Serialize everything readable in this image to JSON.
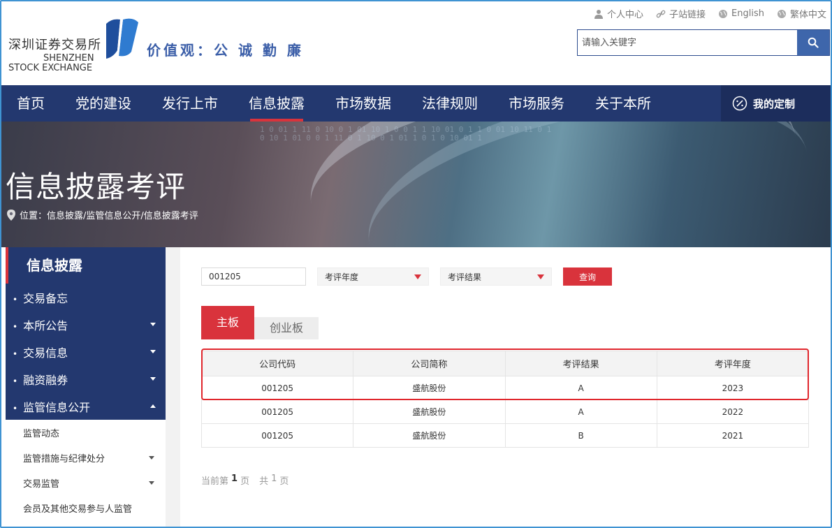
{
  "header": {
    "logo_cn": "深圳证券交易所",
    "logo_en_line1": "SHENZHEN",
    "logo_en_line2": "STOCK EXCHANGE",
    "slogan": "价值观：公 诚 勤 廉",
    "links": [
      {
        "label": "个人中心",
        "icon": "user-icon"
      },
      {
        "label": "子站链接",
        "icon": "link-icon"
      },
      {
        "label": "English",
        "icon": "globe-icon"
      },
      {
        "label": "繁体中文",
        "icon": "globe-icon"
      }
    ],
    "search": {
      "placeholder": "请输入关键字",
      "icon": "search-icon"
    }
  },
  "nav": {
    "items": [
      "首页",
      "党的建设",
      "发行上市",
      "信息披露",
      "市场数据",
      "法律规则",
      "市场服务",
      "关于本所"
    ],
    "active": "信息披露",
    "custom_label": "我的定制"
  },
  "banner": {
    "title": "信息披露考评",
    "breadcrumb": "位置：信息披露/监管信息公开/信息披露考评"
  },
  "sidebar": {
    "title": "信息披露",
    "groups": [
      {
        "label": "交易备忘",
        "caret": ""
      },
      {
        "label": "本所公告",
        "caret": "down"
      },
      {
        "label": "交易信息",
        "caret": "down"
      },
      {
        "label": "融资融券",
        "caret": "down"
      },
      {
        "label": "监管信息公开",
        "caret": "up"
      }
    ],
    "subitems": [
      {
        "label": "监管动态",
        "caret": ""
      },
      {
        "label": "监管措施与纪律处分",
        "caret": "down"
      },
      {
        "label": "交易监管",
        "caret": "down"
      },
      {
        "label": "会员及其他交易参与人监管",
        "caret": ""
      }
    ]
  },
  "filters": {
    "code_value": "001205",
    "year_select": "考评年度",
    "result_select": "考评结果",
    "query_label": "查询"
  },
  "tabs": [
    {
      "label": "主板",
      "active": true
    },
    {
      "label": "创业板",
      "active": false
    }
  ],
  "table": {
    "headers": [
      "公司代码",
      "公司简称",
      "考评结果",
      "考评年度"
    ],
    "rows": [
      [
        "001205",
        "盛航股份",
        "A",
        "2023"
      ],
      [
        "001205",
        "盛航股份",
        "A",
        "2022"
      ],
      [
        "001205",
        "盛航股份",
        "B",
        "2021"
      ]
    ]
  },
  "pager": {
    "prefix": "当前第",
    "current": "1",
    "page_word": "页",
    "total_prefix": "共",
    "total": "1",
    "total_suffix": "页"
  },
  "colors": {
    "nav_bg": "#23386f",
    "accent_red": "#d9333c",
    "search_btn": "#3e66ab"
  }
}
